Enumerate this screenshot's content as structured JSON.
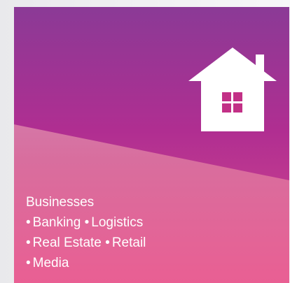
{
  "card": {
    "heading": "Businesses",
    "items": [
      [
        "Banking",
        "Logistics"
      ],
      [
        "Real Estate",
        "Retail"
      ],
      [
        "Media"
      ]
    ],
    "bullet": "•"
  },
  "colors": {
    "card_top": "#8b3a96",
    "card_bottom": "#e95f93",
    "house": "#ffffff",
    "text": "#ffffff"
  },
  "icons": {
    "house": "house-icon"
  }
}
